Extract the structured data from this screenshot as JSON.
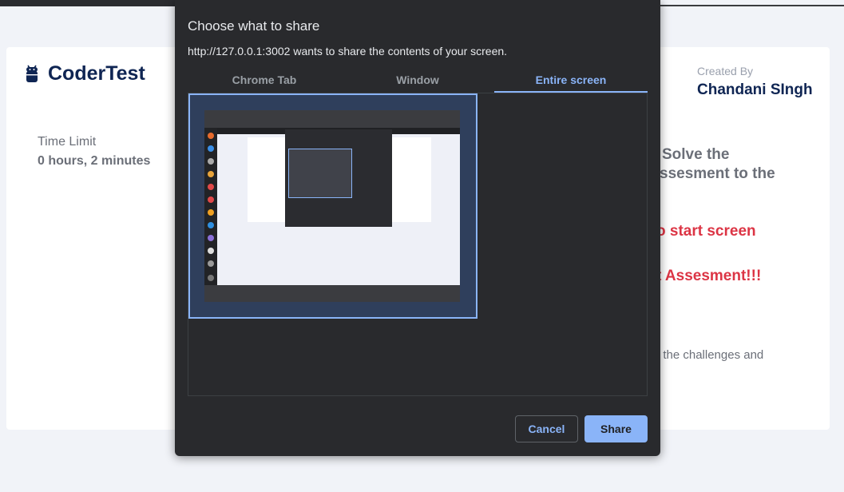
{
  "page": {
    "brand": "CoderTest",
    "time_limit_label": "Time Limit",
    "time_limit_value": "0 hours, 2 minutes",
    "created_by_label": "Created By",
    "created_by_name": "Chandani SIngh",
    "instruction_line_1": "Solve the",
    "instruction_line_2": "ssesment to the",
    "instruction_red_1": "o start screen",
    "instruction_red_2": "t Assesment!!!",
    "instruction_small": "f the challenges and"
  },
  "dialog": {
    "title": "Choose what to share",
    "subtitle": "http://127.0.0.1:3002 wants to share the contents of your screen.",
    "tabs": [
      {
        "label": "Chrome Tab",
        "active": false
      },
      {
        "label": "Window",
        "active": false
      },
      {
        "label": "Entire screen",
        "active": true
      }
    ],
    "cancel_label": "Cancel",
    "share_label": "Share"
  },
  "colors": {
    "accent": "#8ab4f8",
    "brand_navy": "#0f2553",
    "warning_red": "#dc3545",
    "dialog_bg": "#292a2d"
  }
}
